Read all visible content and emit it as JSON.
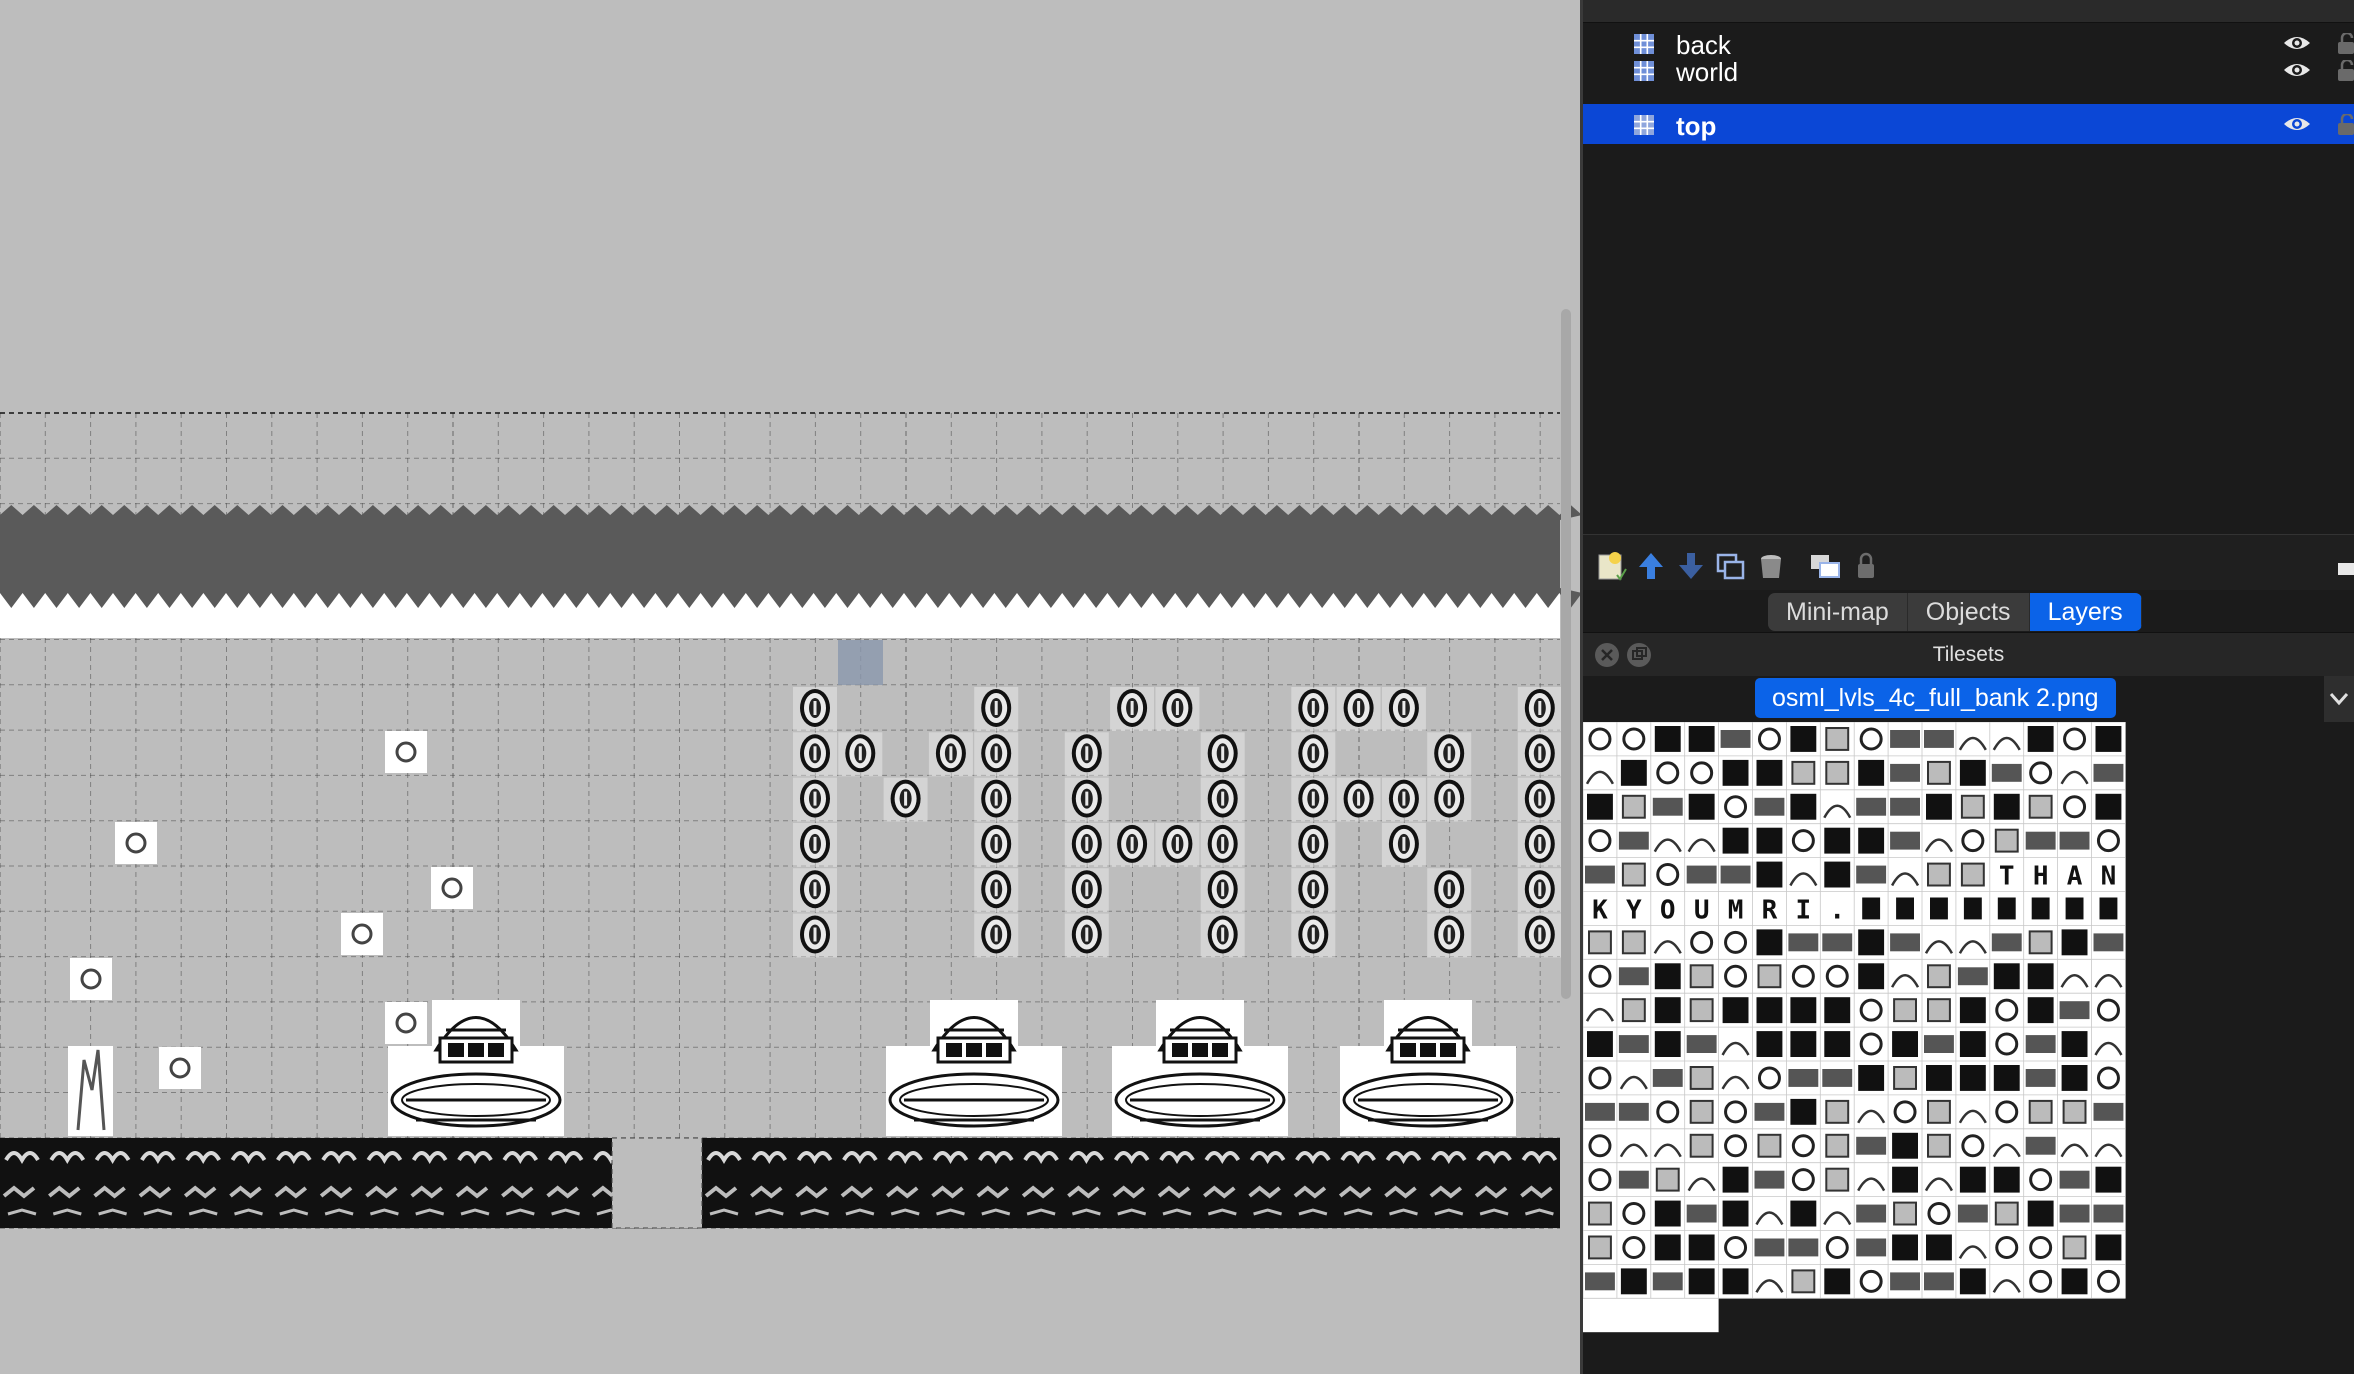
{
  "layers": [
    {
      "name": "back",
      "visible": true,
      "selected": false
    },
    {
      "name": "world",
      "visible": true,
      "selected": false
    },
    {
      "name": "top",
      "visible": true,
      "selected": true
    }
  ],
  "layer_toolbar": [
    {
      "icon": "new-layer-icon"
    },
    {
      "icon": "raise-layer-icon"
    },
    {
      "icon": "lower-layer-icon"
    },
    {
      "icon": "duplicate-layer-icon"
    },
    {
      "icon": "delete-layer-icon"
    },
    {
      "icon": "toggle-other-layers-icon"
    },
    {
      "icon": "lock-layer-icon"
    }
  ],
  "tabs": [
    {
      "label": "Mini-map",
      "active": false
    },
    {
      "label": "Objects",
      "active": false
    },
    {
      "label": "Layers",
      "active": true
    }
  ],
  "tilesets_panel": {
    "title": "Tilesets",
    "active_tileset": "osml_lvls_4c_full_bank 2.png",
    "tile_text_row1": [
      "T",
      "H",
      "A",
      "N"
    ],
    "tile_text_row2": [
      "K",
      "Y",
      "O",
      "U",
      "M",
      "R",
      "I",
      "."
    ]
  },
  "map": {
    "coin_text": "MARI",
    "colors": {
      "background": "#bdbdbd",
      "selection": "#0b47d6",
      "tab_active": "#0b63e8",
      "dark_band": "#5a5a5a",
      "ground": "#111111"
    }
  }
}
